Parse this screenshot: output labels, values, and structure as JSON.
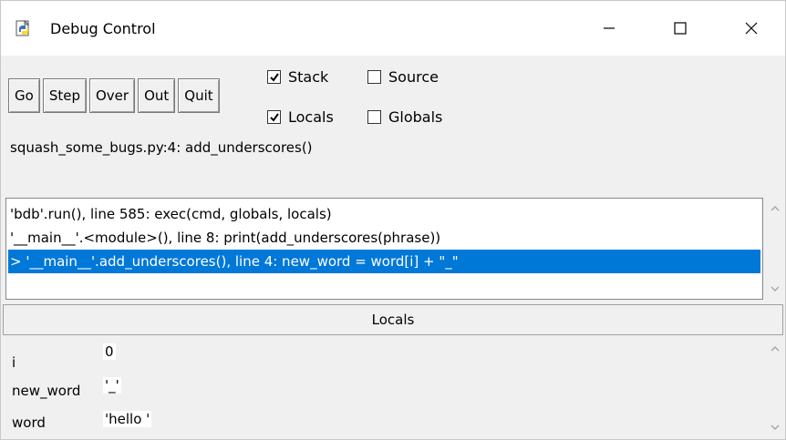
{
  "window": {
    "title": "Debug Control"
  },
  "toolbar": {
    "buttons": [
      "Go",
      "Step",
      "Over",
      "Out",
      "Quit"
    ],
    "checkboxes": [
      {
        "label": "Stack",
        "checked": true
      },
      {
        "label": "Source",
        "checked": false
      },
      {
        "label": "Locals",
        "checked": true
      },
      {
        "label": "Globals",
        "checked": false
      }
    ],
    "status": "squash_some_bugs.py:4: add_underscores()"
  },
  "stack": {
    "rows": [
      "'bdb'.run(), line 585: exec(cmd, globals, locals)",
      "'__main__'.<module>(), line 8: print(add_underscores(phrase))",
      "> '__main__'.add_underscores(), line 4: new_word = word[i] + \"_\""
    ],
    "selected_index": 2
  },
  "locals": {
    "header": "Locals",
    "rows": [
      {
        "name": "i",
        "value": "0"
      },
      {
        "name": "new_word",
        "value": "'_'"
      },
      {
        "name": "word",
        "value": "'hello '"
      }
    ]
  },
  "colors": {
    "selection": "#0078d7",
    "panel": "#f0f0f0"
  }
}
